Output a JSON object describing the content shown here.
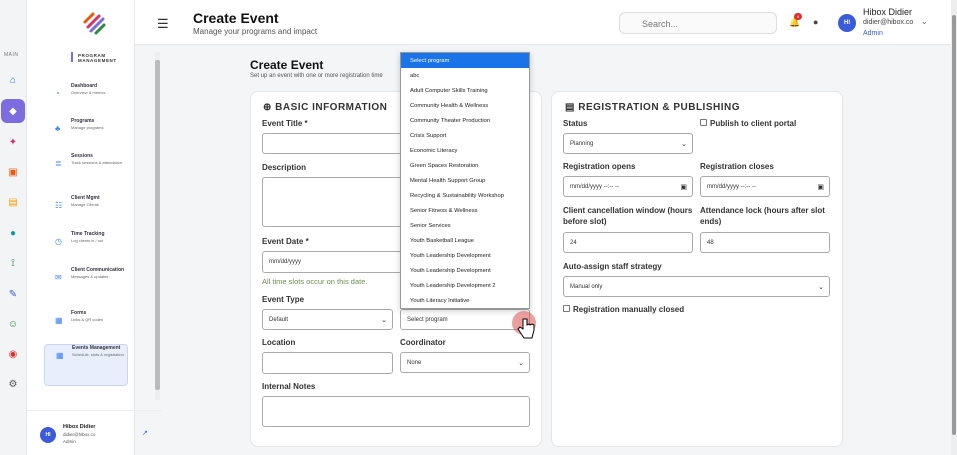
{
  "rail": {
    "label": "MAIN",
    "icons": [
      "home-icon",
      "chart-icon",
      "rocket-icon",
      "calendar-icon",
      "book-icon",
      "target-icon",
      "flow-icon",
      "notes-icon",
      "users-icon",
      "video-icon",
      "settings-icon"
    ],
    "glyphs": [
      "⌂",
      "◆",
      "✦",
      "▣",
      "▤",
      "●",
      "⟟",
      "✎",
      "☺",
      "◉",
      "⚙"
    ]
  },
  "sidebar": {
    "section_title": "PROGRAM MANAGEMENT",
    "items": [
      {
        "title": "Dashboard",
        "sub": "Overview & metrics",
        "icon": "pie-icon",
        "glyph": "◔"
      },
      {
        "title": "Programs",
        "sub": "Manage programs",
        "icon": "tree-icon",
        "glyph": "♣"
      },
      {
        "title": "Sessions",
        "sub": "Track sessions & attendance",
        "icon": "sessions-icon",
        "glyph": "≣"
      },
      {
        "title": "Client Mgmt",
        "sub": "Manage Clients",
        "icon": "clients-icon",
        "glyph": "☷"
      },
      {
        "title": "Time Tracking",
        "sub": "Log clients in / out",
        "icon": "clock-icon",
        "glyph": "◷"
      },
      {
        "title": "Client Communication",
        "sub": "Messages & updates",
        "icon": "chat-icon",
        "glyph": "✉"
      },
      {
        "title": "Forms",
        "sub": "Links & QR codes",
        "icon": "forms-icon",
        "glyph": "▦"
      },
      {
        "title": "Events Management",
        "sub": "Schedule, slots & registration",
        "icon": "events-icon",
        "glyph": "▦"
      }
    ],
    "user": {
      "initials": "HI",
      "name": "Hibox Didier",
      "email": "didier@hibox.co",
      "role": "Admin"
    }
  },
  "header": {
    "title": "Create Event",
    "subtitle": "Manage your programs and impact",
    "search_placeholder": "Search...",
    "notifications": "4",
    "user_initials": "HI",
    "user_name": "Hibox Didier",
    "user_email": "didier@hibox.co",
    "user_role": "Admin"
  },
  "page": {
    "title": "Create Event",
    "subtitle": "Set up an event with one or more registration time"
  },
  "basic": {
    "section": "BASIC INFORMATION",
    "event_title_label": "Event Title *",
    "description_label": "Description",
    "event_date_label": "Event Date *",
    "event_date_placeholder": "mm/dd/yyyy",
    "hint": "All time slots occur on this date.",
    "event_type_label": "Event Type",
    "event_type_value": "Default",
    "program_value": "Select program",
    "location_label": "Location",
    "coordinator_label": "Coordinator",
    "coordinator_value": "None",
    "notes_label": "Internal Notes"
  },
  "registration": {
    "section": "REGISTRATION & PUBLISHING",
    "status_label": "Status",
    "status_value": "Planning",
    "publish_label": "Publish to client portal",
    "opens_label": "Registration opens",
    "opens_value": "mm/dd/yyyy --:-- --",
    "closes_label": "Registration closes",
    "closes_value": "mm/dd/yyyy --:-- --",
    "cancel_label": "Client cancellation window (hours before slot)",
    "cancel_value": "24",
    "lock_label": "Attendance lock (hours after slot ends)",
    "lock_value": "48",
    "strategy_label": "Auto-assign staff strategy",
    "strategy_value": "Manual only",
    "closed_label": "Registration manually closed"
  },
  "program_dropdown": {
    "options": [
      "Select program",
      "abc",
      "Adult Computer Skills Training",
      "Community Health & Wellness",
      "Community Theater Production",
      "Crisis Support",
      "Economic Literacy",
      "Green Spaces Restoration",
      "Mental Health Support Group",
      "Recycling & Sustainability Workshop",
      "Senior Fitness & Wellness",
      "Senior Services",
      "Youth Basketball League",
      "Youth Leadership Development",
      "Youth Leadership Development",
      "Youth Leadership Development 2",
      "Youth Literacy Initiative"
    ],
    "selected_index": 0
  },
  "colors": {
    "accent": "#7c6ce0",
    "primary": "#3b5bdb",
    "highlight": "#1a73e8",
    "hint": "#6b8f4e"
  }
}
